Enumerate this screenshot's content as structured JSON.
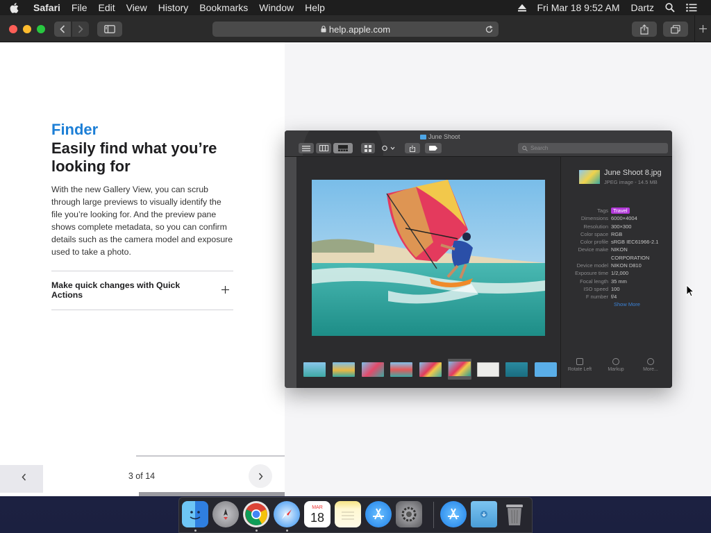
{
  "menubar": {
    "app_name": "Safari",
    "items": [
      "File",
      "Edit",
      "View",
      "History",
      "Bookmarks",
      "Window",
      "Help"
    ],
    "datetime": "Fri Mar 18  9:52 AM",
    "user": "Dartz"
  },
  "toolbar": {
    "url": "help.apple.com"
  },
  "page": {
    "eyebrow": "Finder",
    "headline": "Easily find what you’re looking for",
    "body": "With the new Gallery View, you can scrub through large previews to visually identify the file you’re looking for. And the preview pane shows complete metadata, so you can confirm details such as the camera model and exposure used to take a photo.",
    "accordion_label": "Make quick changes with Quick Actions",
    "pager": {
      "current": 3,
      "total": 14,
      "label": "3 of 14"
    }
  },
  "finder": {
    "window_title": "June Shoot",
    "search_placeholder": "Search",
    "file_name": "June Shoot 8.jpg",
    "file_kind": "JPEG image - 14.5 MB",
    "metadata": [
      {
        "key": "Tags",
        "value": "Travel",
        "tag": true,
        "tag_color": "#b23ad8"
      },
      {
        "key": "Dimensions",
        "value": "6000×4004"
      },
      {
        "key": "Resolution",
        "value": "300×300"
      },
      {
        "key": "Color space",
        "value": "RGB"
      },
      {
        "key": "Color profile",
        "value": "sRGB IEC61966-2.1"
      },
      {
        "key": "Device make",
        "value": "NIKON"
      },
      {
        "key": "",
        "value": "CORPORATION"
      },
      {
        "key": "Device model",
        "value": "NIKON D810"
      },
      {
        "key": "Exposure time",
        "value": "1/2,000"
      },
      {
        "key": "Focal length",
        "value": "35 mm"
      },
      {
        "key": "ISO speed",
        "value": "100"
      },
      {
        "key": "F number",
        "value": "f/4"
      }
    ],
    "show_more": "Show More",
    "actions": [
      "Rotate Left",
      "Markup",
      "More..."
    ]
  },
  "dock": {
    "apps": [
      {
        "name": "finder-app-icon",
        "running": true,
        "color": "#3a8ee6"
      },
      {
        "name": "launchpad-app-icon",
        "running": false,
        "color": "#8a8a8e"
      },
      {
        "name": "chrome-app-icon",
        "running": true,
        "color": "#e8e8e8"
      },
      {
        "name": "safari-app-icon",
        "running": true,
        "color": "#2f8ef0"
      },
      {
        "name": "calendar-app-icon",
        "running": false,
        "color": "#ffffff"
      },
      {
        "name": "notes-app-icon",
        "running": false,
        "color": "#f5e27a"
      },
      {
        "name": "app-store-app-icon",
        "running": false,
        "color": "#1e8ff0"
      },
      {
        "name": "system-preferences-app-icon",
        "running": false,
        "color": "#7a7a7e"
      },
      {
        "name": "app-store-download-icon",
        "running": false,
        "color": "#1e8ff0"
      },
      {
        "name": "downloads-folder-icon",
        "running": false,
        "color": "#5aaee8"
      },
      {
        "name": "trash-icon",
        "running": false,
        "color": "#9a9a9e"
      }
    ],
    "calendar_month": "MAR",
    "calendar_day": "18"
  }
}
